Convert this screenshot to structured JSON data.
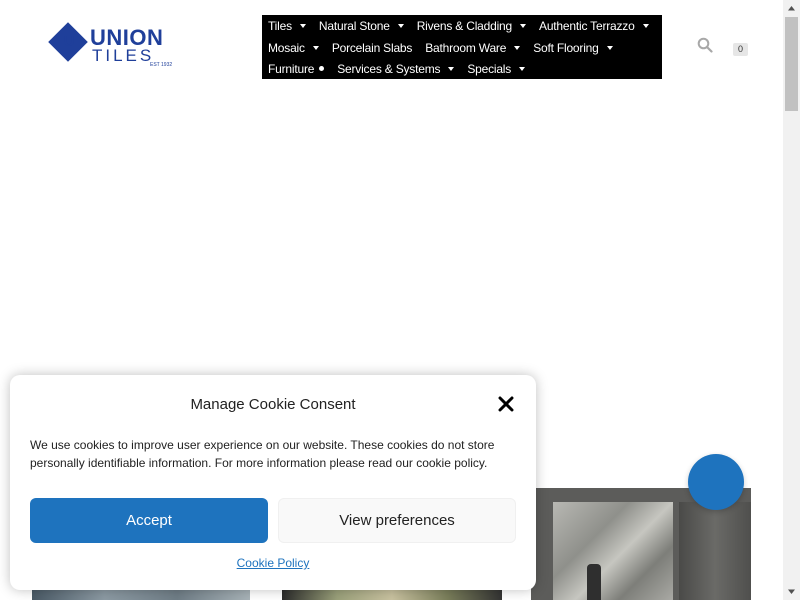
{
  "header": {
    "logo": {
      "name": "UNION",
      "sub": "TILES",
      "est": "EST 1932"
    },
    "nav": {
      "row1": [
        "Tiles",
        "Natural Stone",
        "Rivens & Cladding",
        "Authentic Terrazzo"
      ],
      "row2": [
        "Mosaic",
        "Porcelain Slabs",
        "Bathroom Ware",
        "Soft Flooring"
      ],
      "row3": [
        "Furniture",
        "Services & Systems",
        "Specials"
      ]
    },
    "search_icon": "search-icon",
    "cart_count": "0"
  },
  "cookie_modal": {
    "title": "Manage Cookie Consent",
    "text": "We use cookies to improve user experience on our website.  These cookies do not store personally identifiable information.  For more information please read our cookie policy.",
    "accept_label": "Accept",
    "preferences_label": "View preferences",
    "policy_link": "Cookie Policy",
    "close_icon": "close-icon"
  },
  "colors": {
    "brand": "#1f3f9a",
    "accent": "#1e73be",
    "nav_bg": "#000000"
  }
}
